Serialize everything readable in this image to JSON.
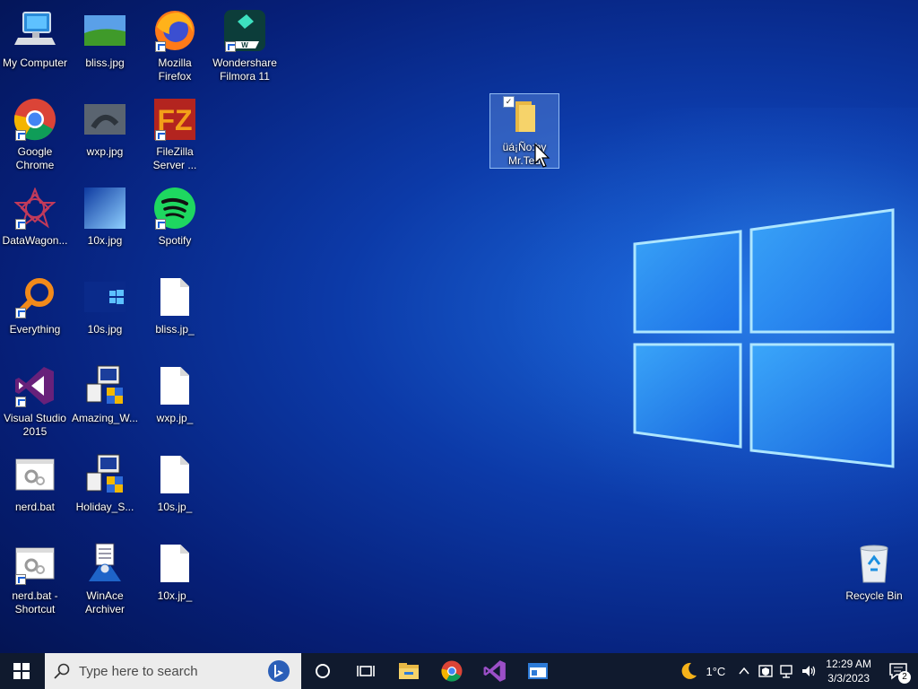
{
  "desktop": {
    "icons": [
      {
        "label": "My Computer",
        "icon": "computer-icon"
      },
      {
        "label": "bliss.jpg",
        "icon": "image-thumbnail-icon"
      },
      {
        "label": "Mozilla Firefox",
        "icon": "firefox-icon"
      },
      {
        "label": "Wondershare Filmora 11",
        "icon": "filmora-icon"
      },
      {
        "label": "Google Chrome",
        "icon": "chrome-icon"
      },
      {
        "label": "wxp.jpg",
        "icon": "image-thumbnail-icon"
      },
      {
        "label": "FileZilla Server ...",
        "icon": "filezilla-icon"
      },
      {
        "label": "DataWagon...",
        "icon": "datawagon-icon"
      },
      {
        "label": "10x.jpg",
        "icon": "image-thumbnail-icon"
      },
      {
        "label": "Spotify",
        "icon": "spotify-icon"
      },
      {
        "label": "Everything",
        "icon": "everything-search-icon"
      },
      {
        "label": "10s.jpg",
        "icon": "image-thumbnail-icon"
      },
      {
        "label": "bliss.jp_",
        "icon": "file-icon"
      },
      {
        "label": "Visual Studio 2015",
        "icon": "visual-studio-icon"
      },
      {
        "label": "Amazing_W...",
        "icon": "installer-icon"
      },
      {
        "label": "wxp.jp_",
        "icon": "file-icon"
      },
      {
        "label": "nerd.bat",
        "icon": "batch-file-icon"
      },
      {
        "label": "Holiday_S...",
        "icon": "installer-icon"
      },
      {
        "label": "10s.jp_",
        "icon": "file-icon"
      },
      {
        "label": "nerd.bat - Shortcut",
        "icon": "batch-file-icon"
      },
      {
        "label": "WinAce Archiver",
        "icon": "winace-icon"
      },
      {
        "label": "10x.jp_",
        "icon": "file-icon"
      },
      {
        "label": "üá¡Ño:by Mr.Ted",
        "icon": "folder-icon"
      },
      {
        "label": "Recycle Bin",
        "icon": "recycle-bin-icon"
      }
    ]
  },
  "taskbar": {
    "search_placeholder": "Type here to search",
    "pinned": [
      "cortana-icon",
      "task-view-icon",
      "file-explorer-icon",
      "chrome-icon",
      "visual-studio-icon",
      "window-app-icon"
    ],
    "weather": "1°C",
    "time": "12:29 AM",
    "date": "3/3/2023",
    "notifications_count": "2"
  }
}
